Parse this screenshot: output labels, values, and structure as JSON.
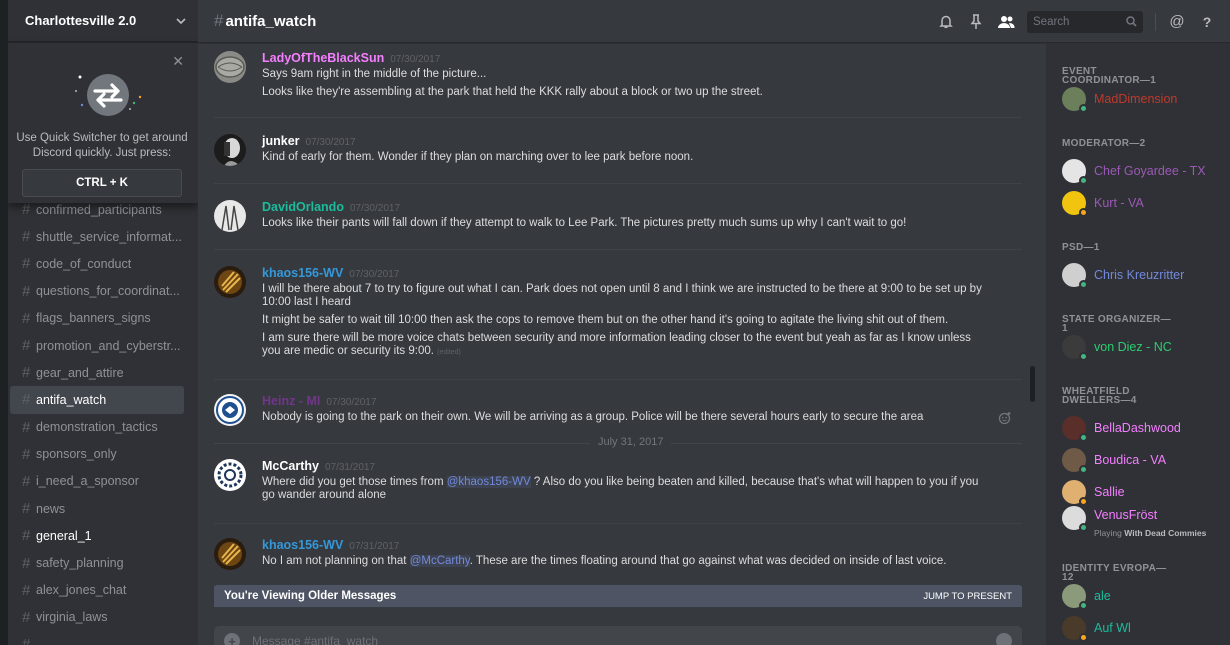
{
  "server": {
    "name": "Charlottesville 2.0"
  },
  "quick_switcher": {
    "text": "Use Quick Switcher to get around Discord quickly. Just press:",
    "shortcut": "CTRL + K"
  },
  "channels": [
    {
      "name": "confirmed_participants",
      "state": "normal"
    },
    {
      "name": "shuttle_service_informat...",
      "state": "normal"
    },
    {
      "name": "code_of_conduct",
      "state": "normal"
    },
    {
      "name": "questions_for_coordinat...",
      "state": "normal"
    },
    {
      "name": "flags_banners_signs",
      "state": "normal"
    },
    {
      "name": "promotion_and_cyberstr...",
      "state": "normal"
    },
    {
      "name": "gear_and_attire",
      "state": "normal"
    },
    {
      "name": "antifa_watch",
      "state": "active"
    },
    {
      "name": "demonstration_tactics",
      "state": "normal"
    },
    {
      "name": "sponsors_only",
      "state": "normal"
    },
    {
      "name": "i_need_a_sponsor",
      "state": "normal"
    },
    {
      "name": "news",
      "state": "normal"
    },
    {
      "name": "general_1",
      "state": "unread"
    },
    {
      "name": "safety_planning",
      "state": "normal"
    },
    {
      "name": "alex_jones_chat",
      "state": "normal"
    },
    {
      "name": "virginia_laws",
      "state": "normal"
    },
    {
      "name": "...",
      "state": "normal"
    }
  ],
  "header": {
    "channel": "antifa_watch",
    "search_placeholder": "Search"
  },
  "messages": [
    {
      "author": "LadyOfTheBlackSun",
      "color": "#f47fff",
      "timestamp": "07/30/2017",
      "lines": [
        "Says 9am right in the middle of the picture...",
        "Looks like they're assembling at the park that held the KKK rally about a block or two up the street."
      ]
    },
    {
      "author": "junker",
      "color": "#ffffff",
      "timestamp": "07/30/2017",
      "lines": [
        "Kind of early for them. Wonder if they plan on marching over to lee park before noon."
      ]
    },
    {
      "author": "DavidOrlando",
      "color": "#1abc9c",
      "timestamp": "07/30/2017",
      "lines": [
        "Looks like their pants will fall down if they attempt to walk to Lee Park.  The pictures pretty much sums up why I can't wait to go!"
      ]
    },
    {
      "author": "khaos156-WV",
      "color": "#3498db",
      "timestamp": "07/30/2017",
      "lines": [
        "I will be there about 7 to try to figure out what I can. Park does not open until 8 and I think we are instructed to be there at 9:00 to be set up by 10:00 last I heard",
        "It might be safer to wait till 10:00 then ask the cops to remove them but on the other hand it's going to agitate the living shit out of them.",
        "I am sure there will be more voice chats between security and more information leading closer to the event but yeah as far as I know unless you are medic or security its 9:00."
      ],
      "edited": "(edited)"
    },
    {
      "author": "Heinz - MI",
      "color": "#71368a",
      "timestamp": "07/30/2017",
      "lines": [
        "Nobody is going to the park on their own. We will be arriving as a group. Police will be there several hours early to secure the area"
      ]
    },
    {
      "author": "McCarthy",
      "color": "#ffffff",
      "timestamp": "07/31/2017",
      "lines": [
        "Where did you get those times from ",
        "@khaos156-WV",
        " ? Also do you like being beaten and killed, because that's what will happen to you if you go wander around alone"
      ]
    },
    {
      "author": "khaos156-WV",
      "color": "#3498db",
      "timestamp": "07/31/2017",
      "lines": [
        "No I am not planning on that ",
        "@McCarthy",
        ". These are the times floating around that go against what was decided on inside of last voice."
      ]
    }
  ],
  "date_divider": "July 31, 2017",
  "older_bar": {
    "label": "You're Viewing Older Messages",
    "jump": "JUMP TO PRESENT"
  },
  "composer": {
    "placeholder": "Message #antifa_watch"
  },
  "roles": [
    {
      "name": "EVENT COORDINATOR—1",
      "members": [
        {
          "name": "MadDimension",
          "color": "#c0392b",
          "status": "online"
        }
      ]
    },
    {
      "name": "MODERATOR—2",
      "members": [
        {
          "name": "Chef Goyardee - TX",
          "color": "#9b59b6",
          "status": "online"
        },
        {
          "name": "Kurt - VA",
          "color": "#9b59b6",
          "status": "idle"
        }
      ]
    },
    {
      "name": "PSD—1",
      "members": [
        {
          "name": "Chris Kreuzritter",
          "color": "#7289da",
          "status": "online"
        }
      ]
    },
    {
      "name": "STATE ORGANIZER—1",
      "members": [
        {
          "name": "von Diez - NC",
          "color": "#2ecc71",
          "status": "online"
        }
      ]
    },
    {
      "name": "WHEATFIELD DWELLERS—4",
      "members": [
        {
          "name": "BellaDashwood",
          "color": "#f47fff",
          "status": "online"
        },
        {
          "name": "Boudica - VA",
          "color": "#f47fff",
          "status": "online"
        },
        {
          "name": "Sallie",
          "color": "#f47fff",
          "status": "idle"
        },
        {
          "name": "VenusFröst",
          "color": "#f47fff",
          "status": "online",
          "playing_prefix": "Playing",
          "playing": "With Dead Commies"
        }
      ]
    },
    {
      "name": "IDENTITY EVROPA—12",
      "members": [
        {
          "name": "ale",
          "color": "#1abc9c",
          "status": "online"
        },
        {
          "name": "Auf Wl",
          "color": "#1abc9c",
          "status": "idle"
        }
      ]
    }
  ],
  "colors": {
    "online": "#43b581",
    "idle": "#faa61a",
    "accent": "#7289da"
  }
}
